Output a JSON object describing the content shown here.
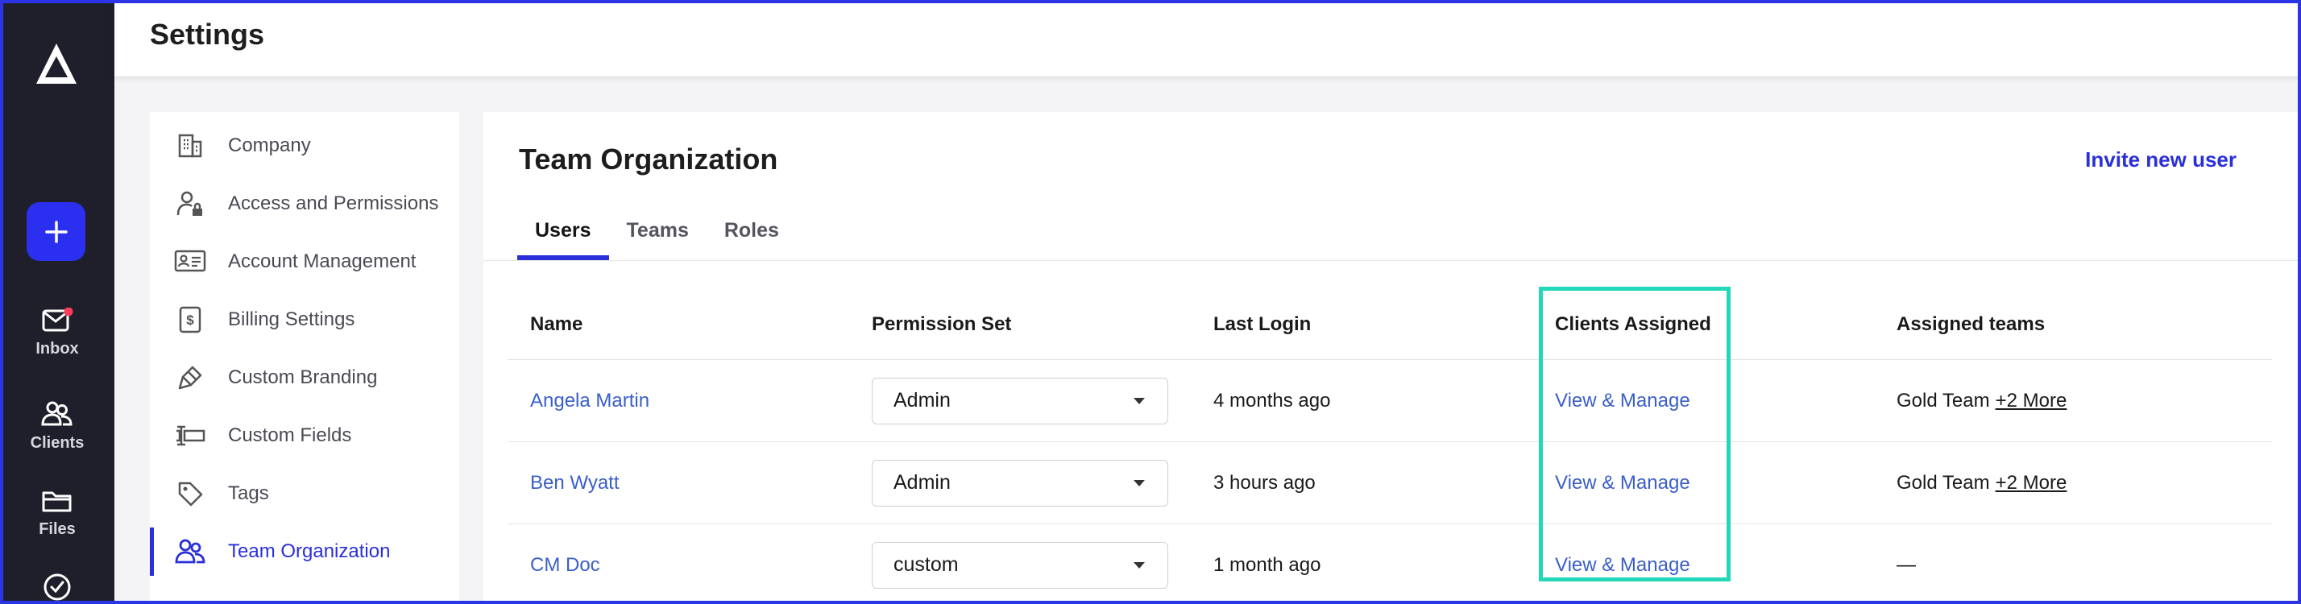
{
  "header": {
    "title": "Settings"
  },
  "rail": {
    "logo_icon": "delta-logo-icon",
    "add_icon": "plus-icon",
    "items": [
      {
        "label": "Inbox",
        "icon": "mail-icon"
      },
      {
        "label": "Clients",
        "icon": "users-icon"
      },
      {
        "label": "Files",
        "icon": "folder-icon"
      },
      {
        "label": "",
        "icon": "check-circle-icon"
      }
    ],
    "notification_color": "#ff3b5c"
  },
  "settings_nav": {
    "items": [
      {
        "label": "Company",
        "icon": "building-icon",
        "active": false
      },
      {
        "label": "Access and Permissions",
        "icon": "user-lock-icon",
        "active": false
      },
      {
        "label": "Account Management",
        "icon": "id-card-icon",
        "active": false
      },
      {
        "label": "Billing Settings",
        "icon": "dollar-doc-icon",
        "active": false
      },
      {
        "label": "Custom Branding",
        "icon": "paintbrush-icon",
        "active": false
      },
      {
        "label": "Custom Fields",
        "icon": "text-field-icon",
        "active": false
      },
      {
        "label": "Tags",
        "icon": "tag-icon",
        "active": false
      },
      {
        "label": "Team Organization",
        "icon": "team-icon",
        "active": true
      }
    ]
  },
  "main": {
    "title": "Team Organization",
    "invite_label": "Invite new user",
    "tabs": [
      {
        "label": "Users",
        "active": true
      },
      {
        "label": "Teams",
        "active": false
      },
      {
        "label": "Roles",
        "active": false
      }
    ],
    "table": {
      "headers": [
        "Name",
        "Permission Set",
        "Last Login",
        "Clients Assigned",
        "Assigned teams"
      ],
      "rows": [
        {
          "name": "Angela Martin",
          "permission": "Admin",
          "last_login": "4 months ago",
          "clients": "View & Manage",
          "team": "Gold Team",
          "more": "+2 More"
        },
        {
          "name": "Ben Wyatt",
          "permission": "Admin",
          "last_login": "3 hours ago",
          "clients": "View & Manage",
          "team": "Gold Team",
          "more": "+2 More"
        },
        {
          "name": "CM Doc",
          "permission": "custom",
          "last_login": "1 month ago",
          "clients": "View & Manage",
          "team": "—",
          "more": ""
        }
      ]
    }
  },
  "colors": {
    "accent": "#2a2fd8",
    "rail_bg": "#1f1f2b",
    "link": "#3b5fc9",
    "highlight": "#22d8b8"
  }
}
